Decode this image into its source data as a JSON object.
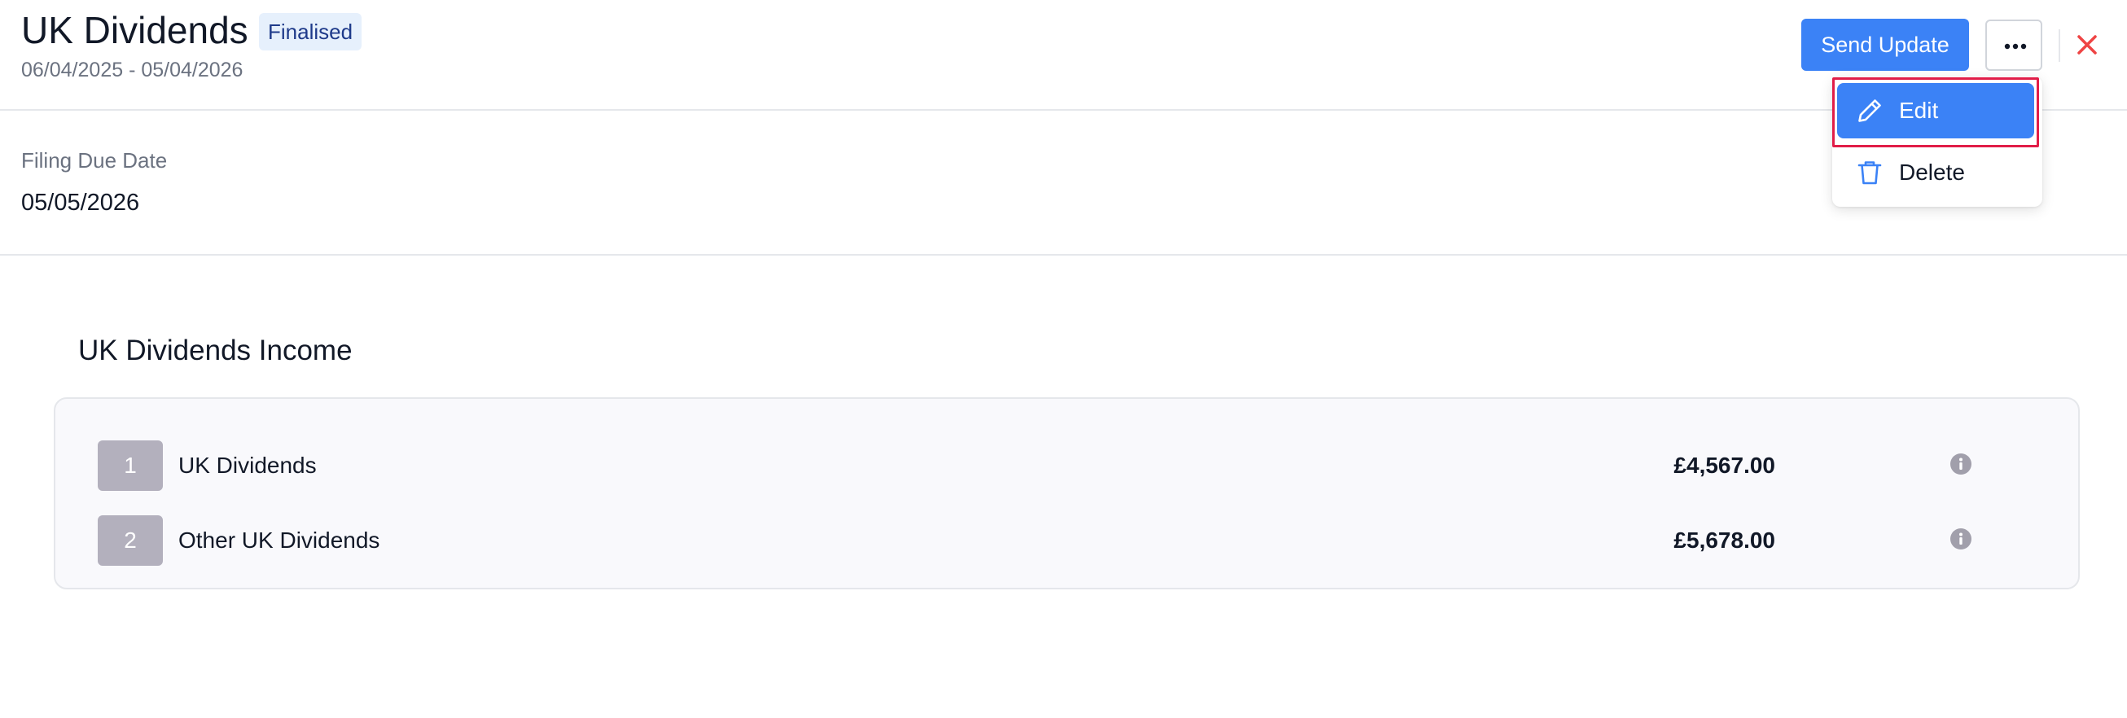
{
  "header": {
    "title": "UK Dividends",
    "status_badge": "Finalised",
    "date_range": "06/04/2025 - 05/04/2026",
    "send_update_label": "Send Update"
  },
  "actions_menu": {
    "items": [
      {
        "label": "Edit",
        "icon": "pencil-icon",
        "highlighted": true
      },
      {
        "label": "Delete",
        "icon": "trash-icon",
        "highlighted": false
      }
    ]
  },
  "filing": {
    "label": "Filing Due Date",
    "value": "05/05/2026"
  },
  "income": {
    "section_title": "UK Dividends Income",
    "rows": [
      {
        "number": "1",
        "label": "UK Dividends",
        "amount": "£4,567.00"
      },
      {
        "number": "2",
        "label": "Other UK Dividends",
        "amount": "£5,678.00"
      }
    ]
  },
  "colors": {
    "accent": "#3b82f6",
    "badge_bg": "#e6f0fc",
    "badge_text": "#1e3a8a",
    "close_red": "#ef4444",
    "highlight_outline": "#e11d48",
    "row_number_bg": "#b3b0bd"
  }
}
